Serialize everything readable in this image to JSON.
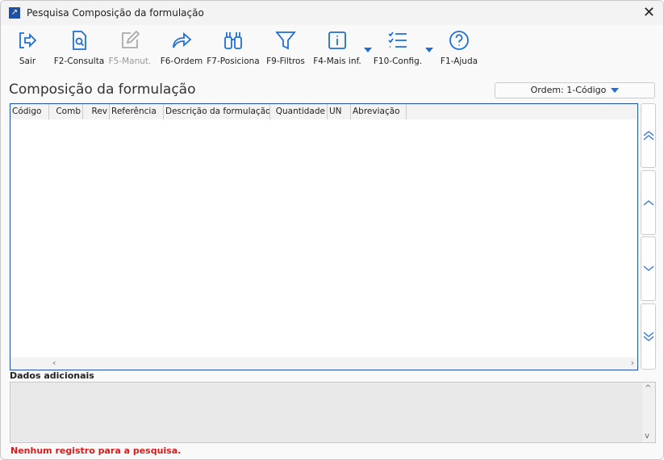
{
  "window": {
    "title": "Pesquisa Composição da formulação"
  },
  "toolbar": [
    {
      "label": "Sair",
      "icon": "exit-icon",
      "enabled": true
    },
    {
      "label": "F2-Consulta",
      "icon": "document-search-icon",
      "enabled": true
    },
    {
      "label": "F5-Manut.",
      "icon": "edit-icon",
      "enabled": false
    },
    {
      "label": "F6-Ordem",
      "icon": "forward-arrow-icon",
      "enabled": true
    },
    {
      "label": "F7-Posiciona",
      "icon": "binoculars-icon",
      "enabled": true
    },
    {
      "label": "F9-Filtros",
      "icon": "filter-icon",
      "enabled": true
    },
    {
      "label": "F4-Mais inf.",
      "icon": "info-icon",
      "enabled": true
    },
    {
      "label": "F10-Config.",
      "icon": "checklist-icon",
      "enabled": true
    },
    {
      "label": "F1-Ajuda",
      "icon": "help-icon",
      "enabled": true
    }
  ],
  "heading": "Composição da formulação",
  "order_select": {
    "value": "Ordem: 1-Código"
  },
  "grid": {
    "columns": [
      "Código",
      "Comb",
      "Rev",
      "Referência",
      "Descrição da formulação",
      "Quantidade",
      "UN",
      "Abreviação"
    ],
    "rows": []
  },
  "details": {
    "label": "Dados adicionais",
    "value": ""
  },
  "status": "Nenhum registro para a pesquisa.",
  "colors": {
    "accent": "#1e6ed8",
    "status": "#d81b1b"
  }
}
